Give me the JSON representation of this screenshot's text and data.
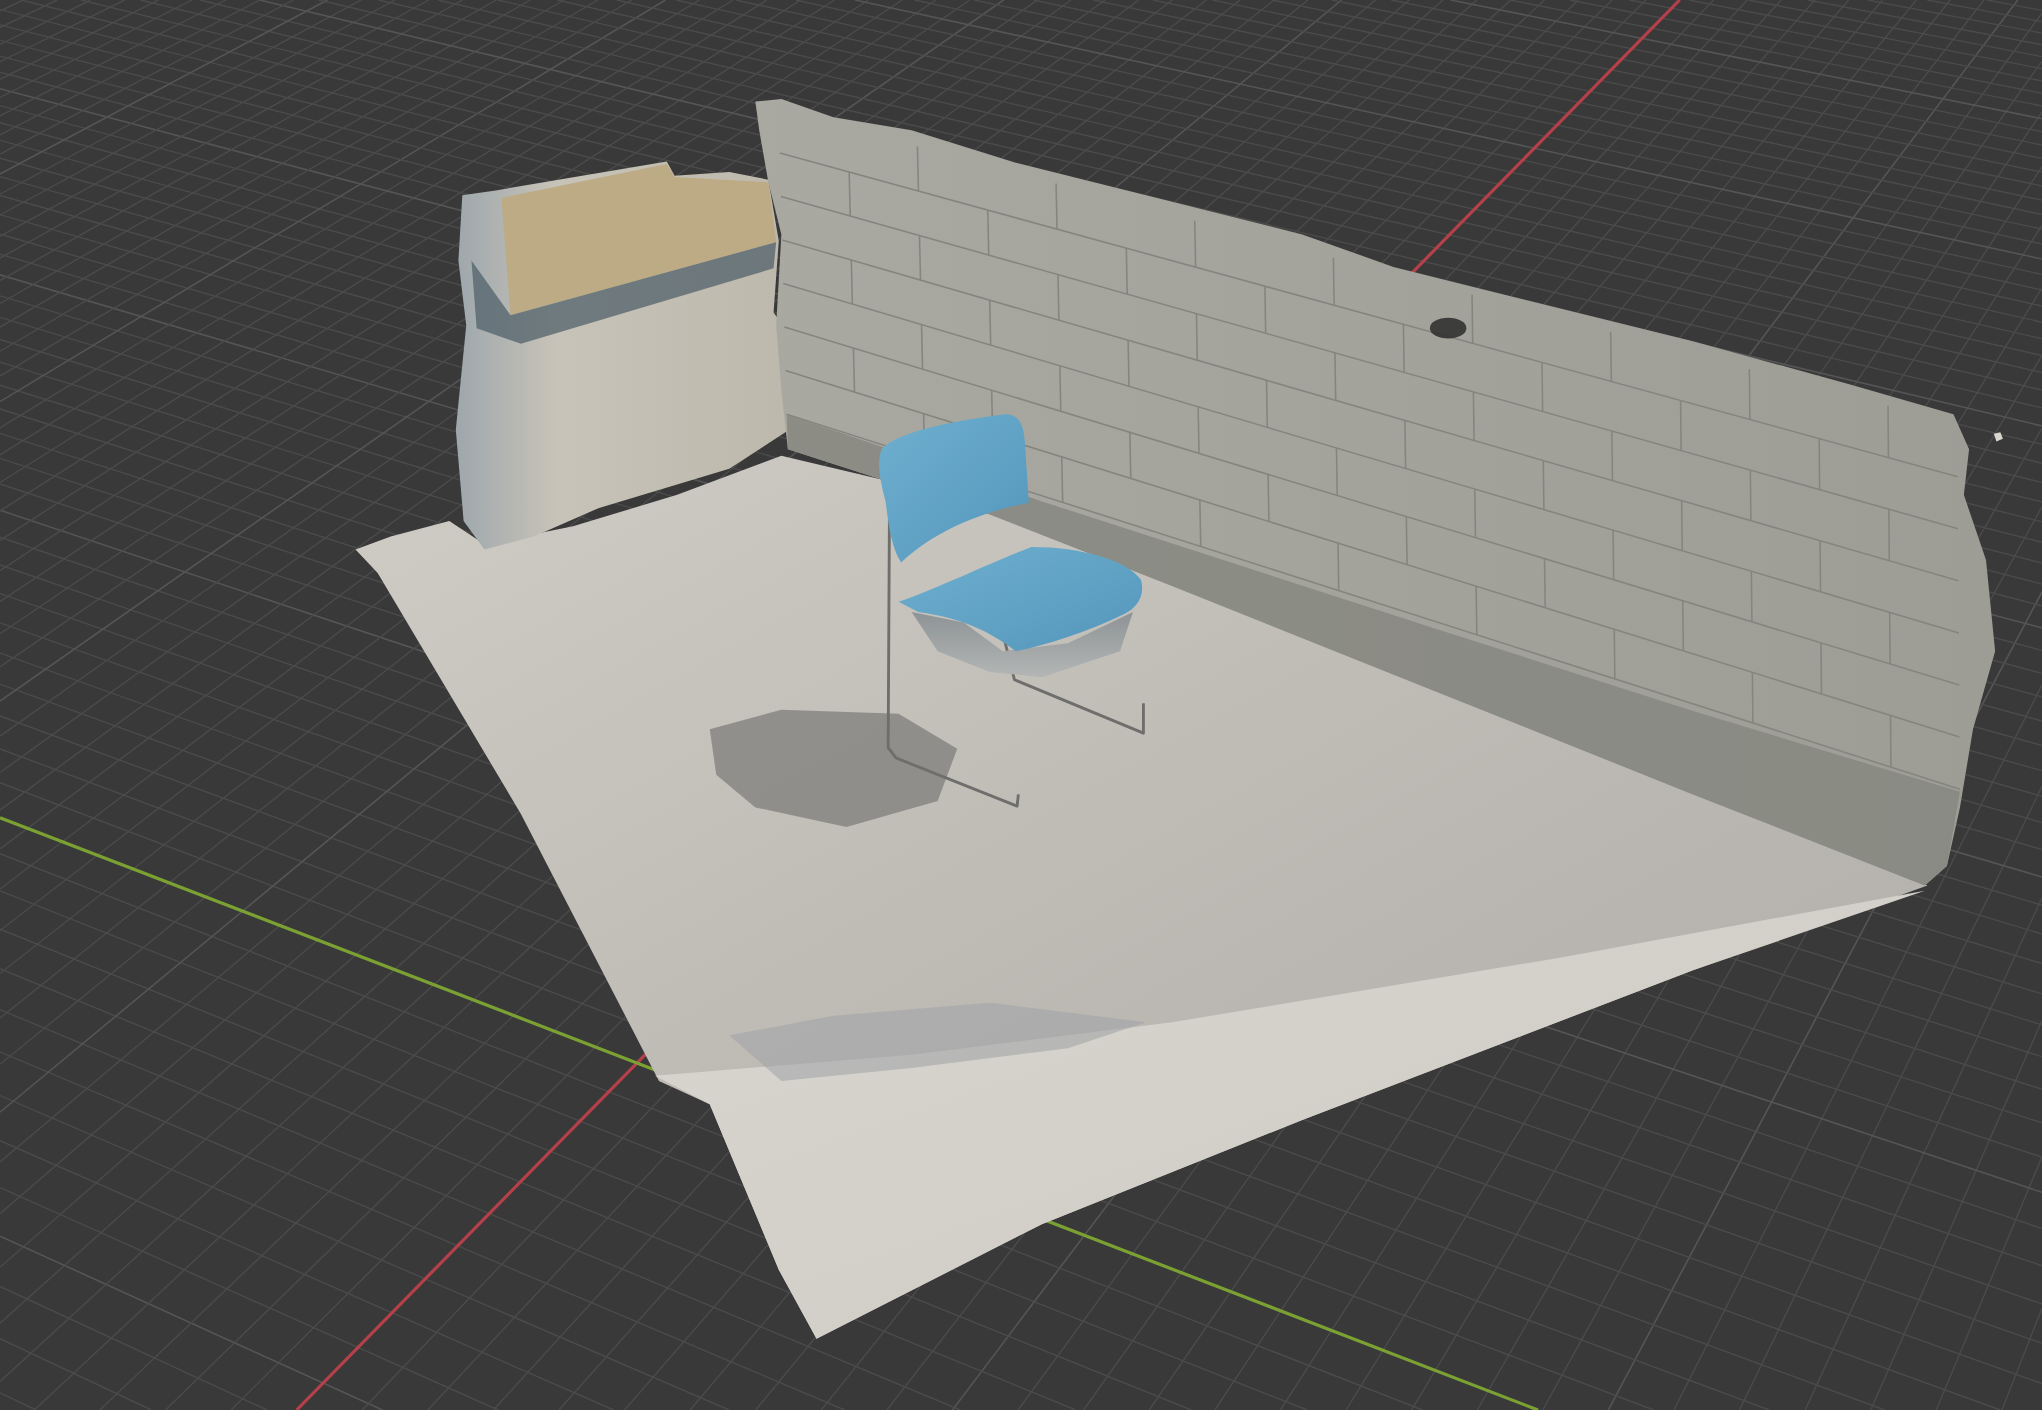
{
  "viewport": {
    "axes": [
      {
        "kind": "x",
        "color": "#b5404a"
      },
      {
        "kind": "y",
        "color": "#7ba133"
      }
    ]
  }
}
